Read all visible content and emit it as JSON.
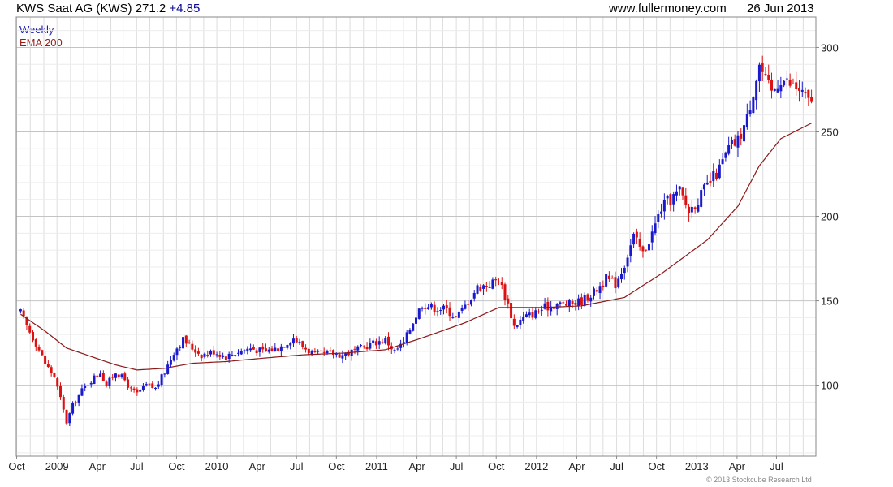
{
  "header": {
    "title": "KWS Saat AG (KWS) 271.2",
    "change": "+4.85",
    "site": "www.fullermoney.com",
    "date": "26 Jun 2013"
  },
  "legend": {
    "period": "Weekly",
    "ma": "EMA 200"
  },
  "copyright": "© 2013 Stockcube Research Ltd",
  "colors": {
    "up": "#1a1acc",
    "down": "#dd1111",
    "ema": "#8b1a1a",
    "grid": "#dddddd"
  },
  "chart_data": {
    "type": "candlestick",
    "title": "KWS Saat AG (KWS) 271.2 +4.85",
    "period": "Weekly",
    "ylim": [
      58,
      318
    ],
    "y_ticks": [
      100,
      150,
      200,
      250,
      300
    ],
    "x_ticks": [
      "Oct",
      "2009",
      "Apr",
      "Jul",
      "Oct",
      "2010",
      "Apr",
      "Jul",
      "Oct",
      "2011",
      "Apr",
      "Jul",
      "Oct",
      "2012",
      "Apr",
      "Jul",
      "Oct",
      "2013",
      "Apr",
      "Jul"
    ],
    "close_anchors": [
      [
        "2008-07-10",
        143
      ],
      [
        "2008-07-24",
        135
      ],
      [
        "2008-08-14",
        125
      ],
      [
        "2008-09-04",
        113
      ],
      [
        "2008-09-25",
        105
      ],
      [
        "2008-10-09",
        92
      ],
      [
        "2008-10-23",
        78
      ],
      [
        "2008-11-06",
        88
      ],
      [
        "2008-11-27",
        97
      ],
      [
        "2008-12-18",
        103
      ],
      [
        "2009-01-08",
        108
      ],
      [
        "2009-01-22",
        100
      ],
      [
        "2009-02-12",
        108
      ],
      [
        "2009-03-05",
        103
      ],
      [
        "2009-03-19",
        97
      ],
      [
        "2009-04-02",
        95
      ],
      [
        "2009-04-23",
        100
      ],
      [
        "2009-05-14",
        98
      ],
      [
        "2009-06-04",
        108
      ],
      [
        "2009-06-25",
        120
      ],
      [
        "2009-07-16",
        127
      ],
      [
        "2009-08-06",
        122
      ],
      [
        "2009-08-27",
        118
      ],
      [
        "2009-09-24",
        120
      ],
      [
        "2009-10-22",
        117
      ],
      [
        "2009-11-19",
        120
      ],
      [
        "2009-12-17",
        122
      ],
      [
        "2010-01-14",
        120
      ],
      [
        "2010-02-18",
        122
      ],
      [
        "2010-03-25",
        128
      ],
      [
        "2010-04-15",
        123
      ],
      [
        "2010-05-13",
        118
      ],
      [
        "2010-06-17",
        119
      ],
      [
        "2010-07-15",
        118
      ],
      [
        "2010-08-19",
        121
      ],
      [
        "2010-09-23",
        125
      ],
      [
        "2010-10-21",
        127
      ],
      [
        "2010-11-11",
        120
      ],
      [
        "2010-12-02",
        125
      ],
      [
        "2010-12-23",
        138
      ],
      [
        "2011-01-13",
        148
      ],
      [
        "2011-02-10",
        146
      ],
      [
        "2011-03-10",
        145
      ],
      [
        "2011-03-31",
        140
      ],
      [
        "2011-04-21",
        147
      ],
      [
        "2011-05-19",
        158
      ],
      [
        "2011-06-16",
        160
      ],
      [
        "2011-07-07",
        163
      ],
      [
        "2011-07-28",
        148
      ],
      [
        "2011-08-11",
        135
      ],
      [
        "2011-09-01",
        140
      ],
      [
        "2011-09-29",
        143
      ],
      [
        "2011-10-20",
        146
      ],
      [
        "2011-11-17",
        148
      ],
      [
        "2011-12-15",
        148
      ],
      [
        "2012-01-12",
        150
      ],
      [
        "2012-02-09",
        155
      ],
      [
        "2012-03-08",
        163
      ],
      [
        "2012-03-29",
        160
      ],
      [
        "2012-04-19",
        172
      ],
      [
        "2012-05-10",
        188
      ],
      [
        "2012-05-31",
        178
      ],
      [
        "2012-06-21",
        190
      ],
      [
        "2012-07-12",
        205
      ],
      [
        "2012-08-02",
        210
      ],
      [
        "2012-08-23",
        215
      ],
      [
        "2012-09-13",
        203
      ],
      [
        "2012-10-04",
        210
      ],
      [
        "2012-10-25",
        218
      ],
      [
        "2012-11-22",
        228
      ],
      [
        "2012-12-13",
        240
      ],
      [
        "2013-01-03",
        245
      ],
      [
        "2013-01-24",
        258
      ],
      [
        "2013-02-07",
        275
      ],
      [
        "2013-02-21",
        290
      ],
      [
        "2013-03-07",
        280
      ],
      [
        "2013-03-21",
        273
      ],
      [
        "2013-04-11",
        282
      ],
      [
        "2013-05-02",
        278
      ],
      [
        "2013-05-23",
        275
      ],
      [
        "2013-06-13",
        268
      ],
      [
        "2013-06-26",
        271
      ]
    ],
    "ema_anchors": [
      [
        "2008-07-10",
        142
      ],
      [
        "2008-09-04",
        132
      ],
      [
        "2008-10-23",
        122
      ],
      [
        "2008-12-18",
        117
      ],
      [
        "2009-02-12",
        112
      ],
      [
        "2009-04-02",
        109
      ],
      [
        "2009-06-04",
        110
      ],
      [
        "2009-08-06",
        113
      ],
      [
        "2009-10-22",
        114
      ],
      [
        "2010-01-14",
        116
      ],
      [
        "2010-04-15",
        118
      ],
      [
        "2010-07-15",
        119
      ],
      [
        "2010-10-21",
        121
      ],
      [
        "2011-01-13",
        128
      ],
      [
        "2011-04-21",
        137
      ],
      [
        "2011-07-07",
        146
      ],
      [
        "2011-10-20",
        146
      ],
      [
        "2012-01-12",
        147
      ],
      [
        "2012-04-19",
        152
      ],
      [
        "2012-07-12",
        166
      ],
      [
        "2012-10-25",
        186
      ],
      [
        "2013-01-03",
        206
      ],
      [
        "2013-02-21",
        230
      ],
      [
        "2013-04-11",
        246
      ],
      [
        "2013-06-26",
        256
      ]
    ]
  }
}
